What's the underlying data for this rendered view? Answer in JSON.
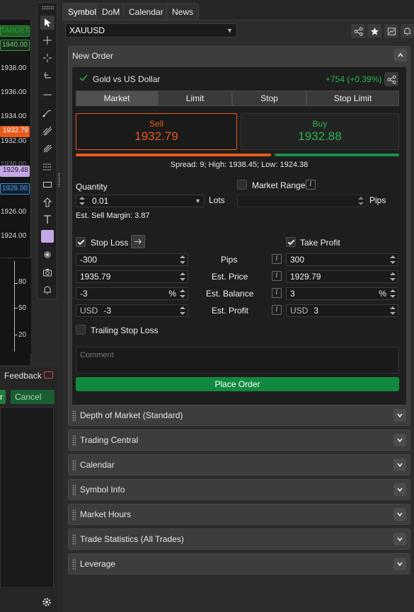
{
  "chart": {
    "prices": [
      "1938.00",
      "1936.00",
      "1934.00",
      "1932.00",
      "1930.00",
      "1928.00",
      "1926.00",
      "1924.00"
    ],
    "target_label": "TARGET",
    "tag_1940": "1940.00",
    "tag_current": "1932.79",
    "tag_purple": "1929.48",
    "tag_blue": "1928.00",
    "osc_ticks": [
      "80",
      "50",
      "20"
    ],
    "colors": {
      "green": "#2e9e3a",
      "orange": "#e8591c",
      "purple": "#c4a7e6",
      "blue": "#3a8ed8"
    }
  },
  "toolbar": {
    "icons": [
      "cursor-icon",
      "crosshair-icon",
      "cross-icon",
      "trendline-icon",
      "hline-icon",
      "ray-icon",
      "channel-icon",
      "pitchfork-icon",
      "fib-icon",
      "rectangle-icon",
      "arrow-icon",
      "text-icon",
      "color-swatch",
      "magnet-icon",
      "camera-icon",
      "alert-icon"
    ]
  },
  "bottom_left": {
    "feedback_label": "Feedback",
    "btn_partial": "r",
    "cancel_all_label": "Cancel All"
  },
  "tabs": [
    "Symbol",
    "DoM",
    "Calendar",
    "News"
  ],
  "symbol_select": "XAUUSD",
  "new_order": {
    "title": "New Order",
    "instrument": "Gold vs US Dollar",
    "change": "+754 (+0.39%)",
    "order_types": [
      "Market",
      "Limit",
      "Stop",
      "Stop Limit"
    ],
    "sell_label": "Sell",
    "sell_price": "1932.79",
    "buy_label": "Buy",
    "buy_price": "1932.88",
    "spread_line": "Spread: 9; High: 1938.45; Low: 1924.38",
    "quantity_label": "Quantity",
    "quantity_value": "0.01",
    "lots_label": "Lots",
    "market_range_label": "Market Range",
    "pips_label": "Pips",
    "est_sell_margin": "Est. Sell Margin: 3.87",
    "stop_loss_label": "Stop Loss",
    "take_profit_label": "Take Profit",
    "rows": [
      {
        "label": "Pips",
        "sl": "-300",
        "tp": "300",
        "unit": ""
      },
      {
        "label": "Est. Price",
        "sl": "1935.79",
        "tp": "1929.79",
        "unit": ""
      },
      {
        "label": "Est. Balance",
        "sl": "-3",
        "tp": "3",
        "unit": "%"
      },
      {
        "label": "Est. Profit",
        "sl": "-3",
        "tp": "3",
        "unit": "USD"
      }
    ],
    "trailing_stop_label": "Trailing Stop Loss",
    "comment_placeholder": "Comment",
    "place_order_label": "Place Order"
  },
  "sections": [
    "Depth of Market (Standard)",
    "Trading Central",
    "Calendar",
    "Symbol Info",
    "Market Hours",
    "Trade Statistics (All Trades)",
    "Leverage"
  ],
  "colors": {
    "sell": "#e8591c",
    "buy": "#2ab44a",
    "place_order": "#118a3f",
    "change": "#2ab44a"
  }
}
